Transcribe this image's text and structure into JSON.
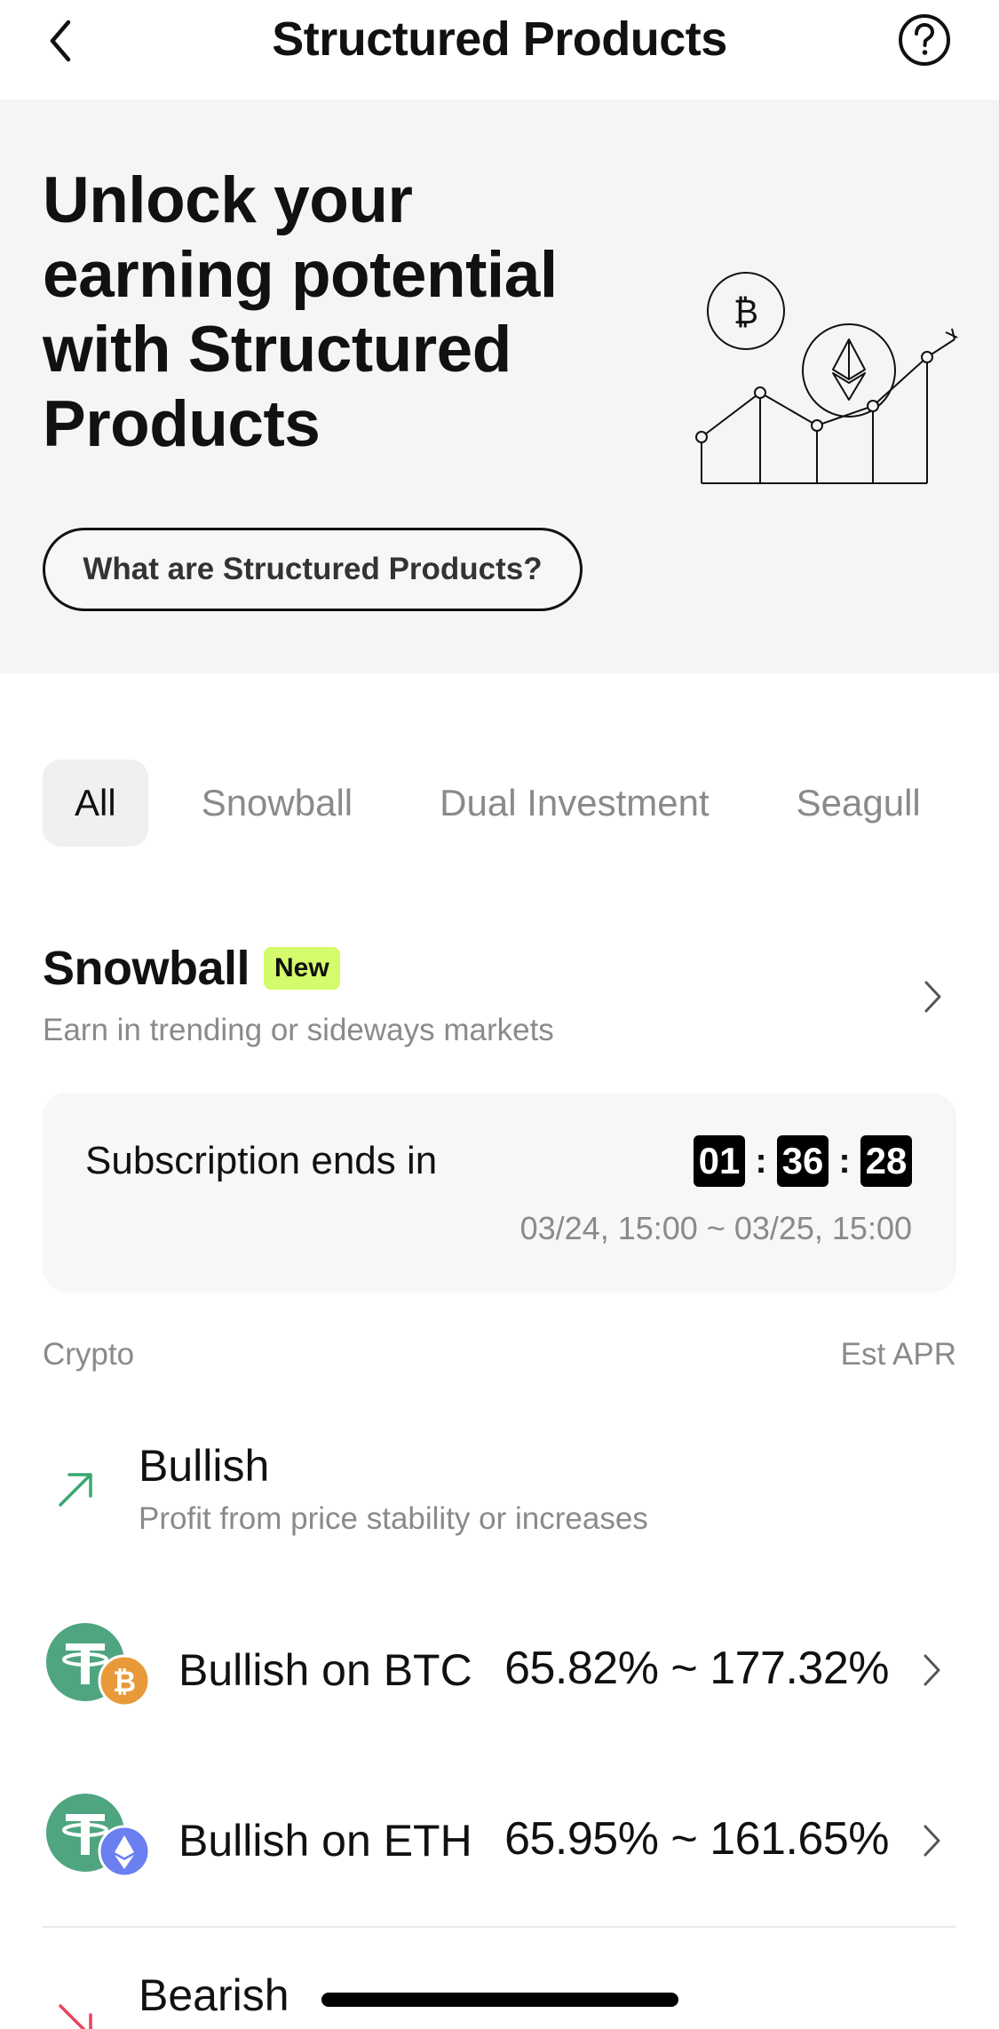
{
  "header": {
    "title": "Structured Products"
  },
  "hero": {
    "title": "Unlock your earning potential with Structured Products",
    "button_label": "What are Structured Products?"
  },
  "tabs": [
    {
      "label": "All",
      "active": true
    },
    {
      "label": "Snowball",
      "active": false
    },
    {
      "label": "Dual Investment",
      "active": false
    },
    {
      "label": "Seagull",
      "active": false
    }
  ],
  "section": {
    "title": "Snowball",
    "badge": "New",
    "subtitle": "Earn in trending or sideways markets"
  },
  "subscription": {
    "label": "Subscription ends in",
    "hours": "01",
    "minutes": "36",
    "seconds": "28",
    "separator": ":",
    "range": "03/24, 15:00 ~ 03/25, 15:00"
  },
  "columns": {
    "left": "Crypto",
    "right": "Est APR"
  },
  "categories": [
    {
      "title": "Bullish",
      "description": "Profit from price stability or increases"
    },
    {
      "title": "Bearish"
    }
  ],
  "products": [
    {
      "name": "Bullish on BTC",
      "apr": "65.82% ~ 177.32%"
    },
    {
      "name": "Bullish on ETH",
      "apr": "65.95% ~ 161.65%"
    }
  ],
  "colors": {
    "accent_badge": "#d4fb6b",
    "bullish_green": "#3aa76d",
    "bearish_red": "#e8435b",
    "usdt_green": "#4fa580",
    "btc_orange": "#e89a3a",
    "eth_blue": "#6a7ff0"
  },
  "icons": {
    "back": "chevron-left-icon",
    "help": "question-circle-icon",
    "row_chevron": "chevron-right-icon",
    "bullish": "arrow-up-right-icon",
    "bearish": "arrow-down-right-icon"
  }
}
